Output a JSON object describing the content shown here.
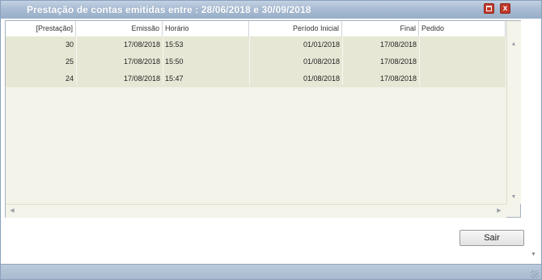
{
  "window": {
    "title": "Prestação de contas emitidas entre : 28/06/2018 e 30/09/2018",
    "maximize_symbol": "",
    "close_symbol": "x"
  },
  "table": {
    "headers": {
      "prestacao": "[Prestação]",
      "emissao": "Emissão",
      "horario": "Horário",
      "periodo_inicial": "Período Inicial",
      "final": "Final",
      "pedido": "Pedido"
    },
    "rows": [
      {
        "prestacao": "30",
        "emissao": "17/08/2018",
        "horario": "15:53",
        "periodo_inicial": "01/01/2018",
        "final": "17/08/2018",
        "pedido": ""
      },
      {
        "prestacao": "25",
        "emissao": "17/08/2018",
        "horario": "15:50",
        "periodo_inicial": "01/08/2018",
        "final": "17/08/2018",
        "pedido": ""
      },
      {
        "prestacao": "24",
        "emissao": "17/08/2018",
        "horario": "15:47",
        "periodo_inicial": "01/08/2018",
        "final": "17/08/2018",
        "pedido": ""
      }
    ]
  },
  "buttons": {
    "sair": "Sair"
  },
  "icons": {
    "scroll_up": "▲",
    "scroll_down": "▼",
    "scroll_left": "◀",
    "scroll_right": "▶"
  },
  "colors": {
    "titlebar": "#a9bcd3",
    "row_bg": "#e7e7d6",
    "grid_bg": "#f3f3e9",
    "window_button": "#c0392b"
  }
}
